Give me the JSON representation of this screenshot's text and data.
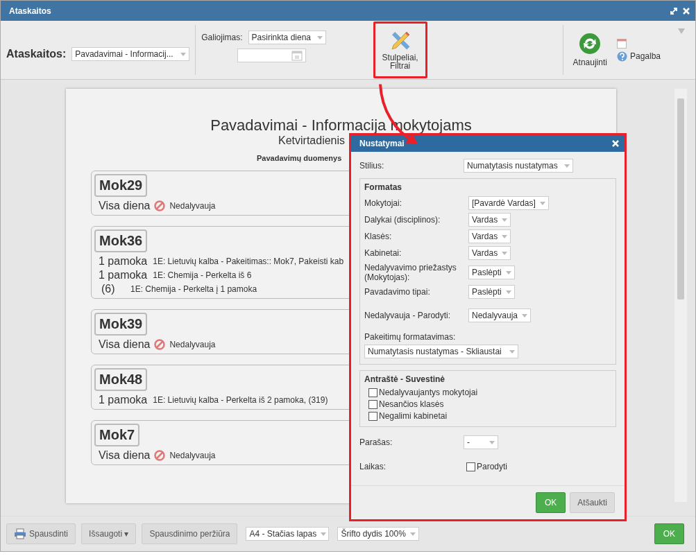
{
  "window": {
    "title": "Ataskaitos"
  },
  "toolbar": {
    "report_label": "Ataskaitos:",
    "report_select": "Pavadavimai - Informacij...",
    "validity_label": "Galiojimas:",
    "validity_select": "Pasirinkta diena",
    "columns_button": "Stulpeliai, Filtrai",
    "refresh_button": "Atnaujinti",
    "help_button": "Pagalba"
  },
  "report": {
    "title": "Pavadavimai - Informacija mokytojams",
    "subtitle": "Ketvirtadienis",
    "section": "Pavadavimų duomenys",
    "teachers": [
      {
        "name": "Mok29",
        "entries": [
          {
            "kind": "absent",
            "time": "Visa diena",
            "text": "Nedalyvauja"
          }
        ]
      },
      {
        "name": "Mok36",
        "entries": [
          {
            "kind": "lesson",
            "time": "1 pamoka",
            "text": "1E: Lietuvių kalba - Pakeitimas:: Mok7, Pakeisti kab"
          },
          {
            "kind": "lesson",
            "time": "1 pamoka",
            "text": "1E: Chemija - Perkelta iš 6"
          },
          {
            "kind": "moved",
            "time": "(6)",
            "text": "1E: Chemija - Perkelta į 1 pamoka"
          }
        ]
      },
      {
        "name": "Mok39",
        "entries": [
          {
            "kind": "absent",
            "time": "Visa diena",
            "text": "Nedalyvauja"
          }
        ]
      },
      {
        "name": "Mok48",
        "entries": [
          {
            "kind": "lesson",
            "time": "1 pamoka",
            "text": "1E: Lietuvių kalba - Perkelta iš 2 pamoka, (319)"
          }
        ]
      },
      {
        "name": "Mok7",
        "entries": [
          {
            "kind": "absent",
            "time": "Visa diena",
            "text": "Nedalyvauja"
          }
        ]
      }
    ]
  },
  "dialog": {
    "title": "Nustatymai",
    "style": {
      "label": "Stilius:",
      "value": "Numatytasis nustatymas"
    },
    "format": {
      "title": "Formatas",
      "rows": [
        {
          "label": "Mokytojai:",
          "value": "[Pavardė Vardas]"
        },
        {
          "label": "Dalykai (disciplinos):",
          "value": "Vardas"
        },
        {
          "label": "Klasės:",
          "value": "Vardas"
        },
        {
          "label": "Kabinetai:",
          "value": "Vardas"
        },
        {
          "label": "Nedalyvavimo priežastys (Mokytojas):",
          "value": "Paslėpti"
        },
        {
          "label": "Pavadavimo tipai:",
          "value": "Paslėpti"
        },
        {
          "label": "Nedalyvauja - Parodyti:",
          "value": "Nedalyvauja"
        }
      ],
      "change_label": "Pakeitimų formatavimas:",
      "change_value": "Numatytasis nustatymas - Skliaustai"
    },
    "summary": {
      "title": "Antraštė - Suvestinė",
      "options": [
        {
          "label": "Nedalyvaujantys mokytojai",
          "checked": false
        },
        {
          "label": "Nesančios klasės",
          "checked": false
        },
        {
          "label": "Negalimi kabinetai",
          "checked": false
        }
      ]
    },
    "signature": {
      "label": "Parašas:",
      "value": "-"
    },
    "time": {
      "label": "Laikas:",
      "option": "Parodyti",
      "checked": false
    },
    "ok": "OK",
    "cancel": "Atšaukti"
  },
  "footer": {
    "print": "Spausdinti",
    "save": "Išsaugoti ▾",
    "preview": "Spausdinimo peržiūra",
    "paper": "A4 - Stačias lapas",
    "font": "Šrifto dydis 100%",
    "ok": "OK"
  }
}
